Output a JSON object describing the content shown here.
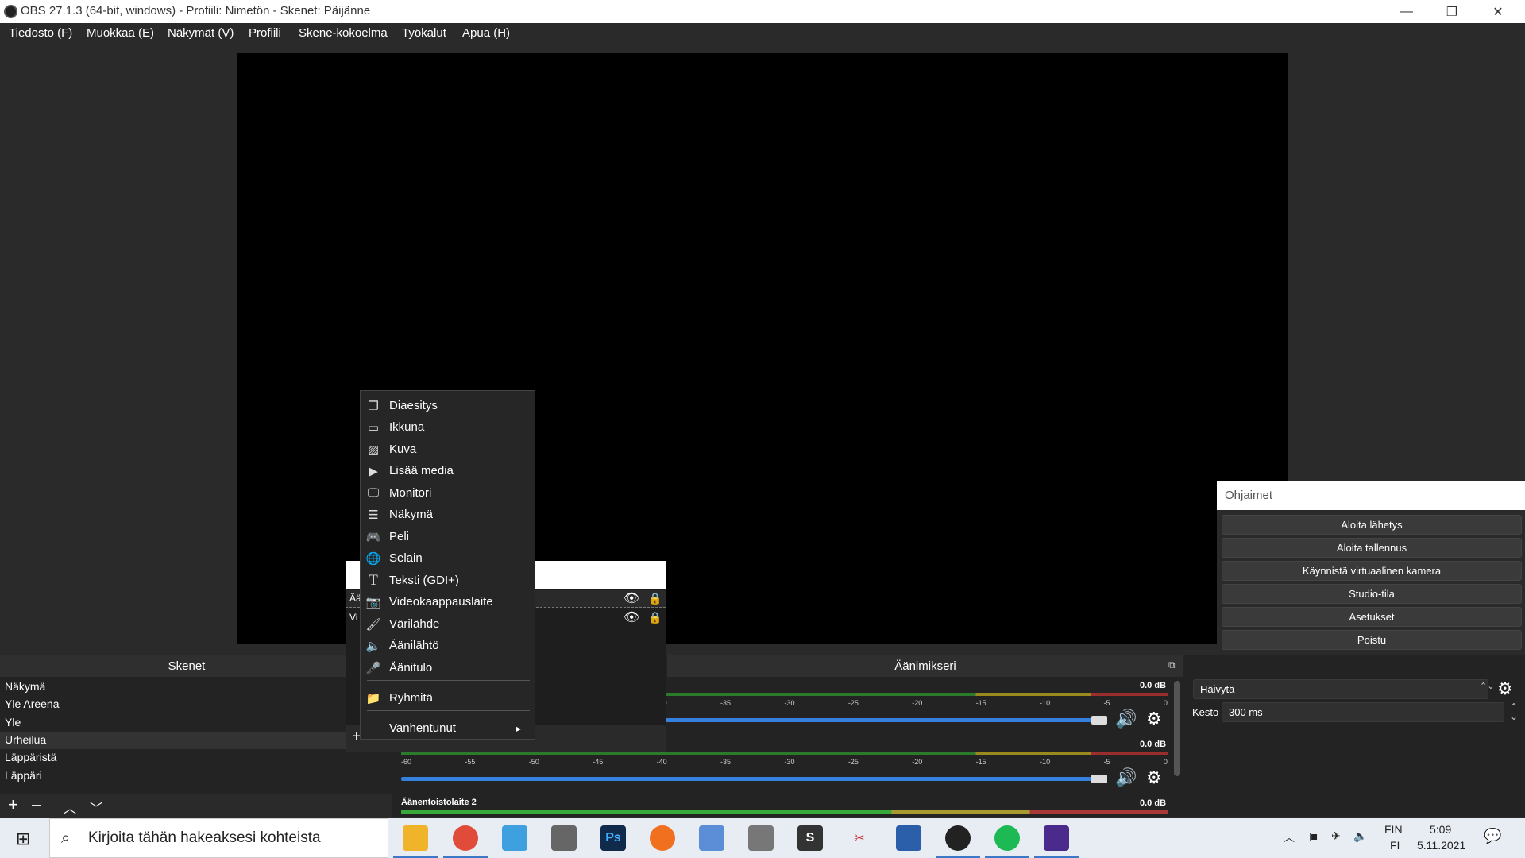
{
  "window": {
    "title": "OBS 27.1.3 (64-bit, windows) - Profiili: Nimetön - Skenet: Päijänne",
    "minimize": "—",
    "restore": "❐",
    "close": "✕"
  },
  "menubar": {
    "items": [
      "Tiedosto (F)",
      "Muokkaa (E)",
      "Näkymät (V)",
      "Profiili",
      "Skene-kokoelma",
      "Työkalut",
      "Apua (H)"
    ]
  },
  "controls": {
    "title": "Ohjaimet",
    "buttons": [
      "Aloita lähetys",
      "Aloita tallennus",
      "Käynnistä virtuaalinen kamera",
      "Studio-tila",
      "Asetukset",
      "Poistu"
    ]
  },
  "scenes": {
    "title": "Skenet",
    "items": [
      "Näkymä",
      "Yle Areena",
      "Yle",
      "Urheilua",
      "Läppäristä",
      "Läppäri"
    ],
    "selected_index": 3
  },
  "sources": {
    "rows": [
      "Ää",
      "Vi"
    ]
  },
  "mixer": {
    "title": "Äänimikseri",
    "channels": [
      {
        "name": "",
        "db": "0.0 dB"
      },
      {
        "name": "",
        "db": "0.0 dB"
      },
      {
        "name": "Äänentoistolaite 2",
        "db": "0.0 dB"
      }
    ],
    "ticks": [
      "-60",
      "-55",
      "-50",
      "-45",
      "-40",
      "-35",
      "-30",
      "-25",
      "-20",
      "-15",
      "-10",
      "-5",
      "0"
    ]
  },
  "transitions": {
    "selected": "Häivytä",
    "duration_label": "Kesto",
    "duration_value": "300 ms"
  },
  "context_menu": {
    "items": [
      {
        "label": "Diaesitys",
        "icon": "slideshow-icon"
      },
      {
        "label": "Ikkuna",
        "icon": "window-icon"
      },
      {
        "label": "Kuva",
        "icon": "image-icon"
      },
      {
        "label": "Lisää media",
        "icon": "media-play-icon"
      },
      {
        "label": "Monitori",
        "icon": "monitor-icon"
      },
      {
        "label": "Näkymä",
        "icon": "list-icon"
      },
      {
        "label": "Peli",
        "icon": "gamepad-icon"
      },
      {
        "label": "Selain",
        "icon": "globe-icon"
      },
      {
        "label": "Teksti (GDI+)",
        "icon": "text-icon"
      },
      {
        "label": "Videokaappauslaite",
        "icon": "camera-icon"
      },
      {
        "label": "Värilähde",
        "icon": "brush-icon"
      },
      {
        "label": "Äänilähtö",
        "icon": "speaker-icon"
      },
      {
        "label": "Äänitulo",
        "icon": "microphone-icon"
      }
    ],
    "group": {
      "label": "Ryhmitä",
      "icon": "folder-icon"
    },
    "deprecated": {
      "label": "Vanhentunut",
      "arrow": "▸"
    }
  },
  "taskbar": {
    "search_placeholder": "Kirjoita tähän hakeaksesi kohteista",
    "lang_top": "FIN",
    "lang_bottom": "FI",
    "time": "5:09",
    "date": "5.11.2021",
    "ps_label": "Ps",
    "s_label": "S"
  }
}
